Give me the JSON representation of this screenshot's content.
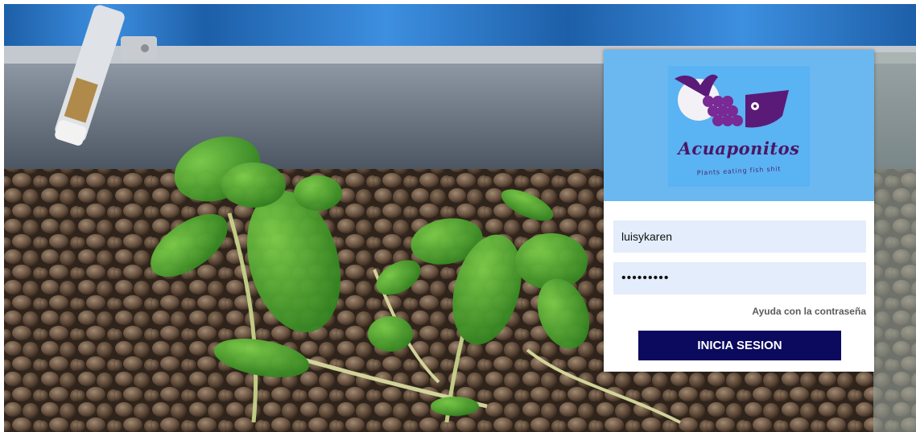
{
  "logo": {
    "name": "Acuaponitos",
    "tagline": "Plants eating fish shit"
  },
  "login": {
    "username_value": "luisykaren",
    "password_masked": "•••••••••",
    "help_link": "Ayuda con la contraseña",
    "submit_label": "INICIA SESION"
  },
  "colors": {
    "header_bg": "#6ab8ef",
    "logo_purple": "#5a1a78",
    "field_bg": "#e4edfb",
    "button_bg": "#0b0a5e"
  },
  "icons": {
    "logo": "fish-grapes-logo-icon",
    "sensor": "sensor-probe-icon"
  }
}
